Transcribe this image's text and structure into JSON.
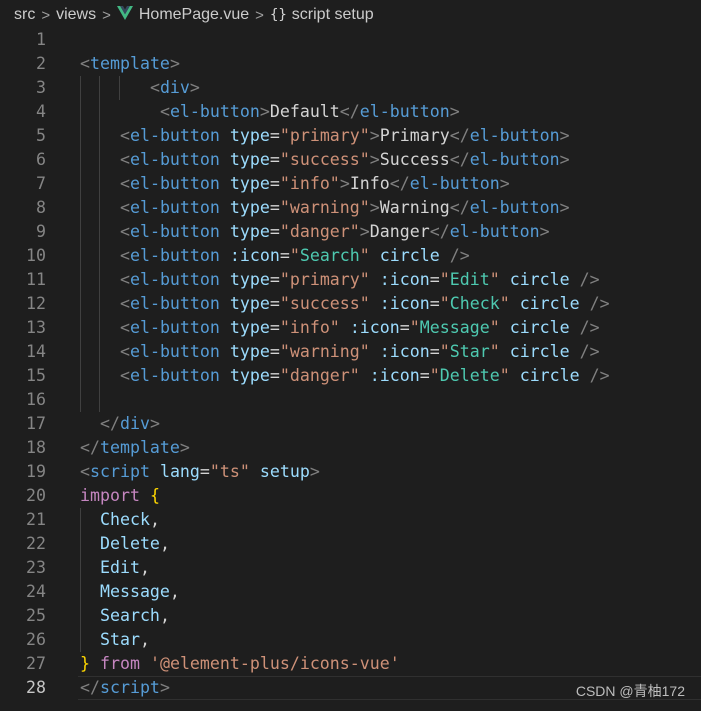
{
  "breadcrumb": {
    "segments": [
      "src",
      "views",
      "HomePage.vue",
      "script setup"
    ],
    "separator": ">",
    "file_icon": "vue-logo-icon",
    "symbol_icon": "braces-icon",
    "symbol_glyph": "{}"
  },
  "editor": {
    "active_line": 28,
    "lines": [
      {
        "n": "1",
        "t": []
      },
      {
        "n": "2",
        "t": [
          [
            "t-p",
            "<"
          ],
          [
            "t-tag",
            "template"
          ],
          [
            "t-p",
            ">"
          ]
        ]
      },
      {
        "n": "3",
        "t": [
          [
            "t-txt",
            "       "
          ],
          [
            "t-p",
            "<"
          ],
          [
            "t-tag",
            "div"
          ],
          [
            "t-p",
            ">"
          ]
        ]
      },
      {
        "n": "4",
        "t": [
          [
            "t-txt",
            "        "
          ],
          [
            "t-p",
            "<"
          ],
          [
            "t-tag",
            "el-button"
          ],
          [
            "t-p",
            ">"
          ],
          [
            "t-txt",
            "Default"
          ],
          [
            "t-p",
            "</"
          ],
          [
            "t-tag",
            "el-button"
          ],
          [
            "t-p",
            ">"
          ]
        ]
      },
      {
        "n": "5",
        "t": [
          [
            "t-txt",
            "    "
          ],
          [
            "t-p",
            "<"
          ],
          [
            "t-tag",
            "el-button"
          ],
          [
            "t-txt",
            " "
          ],
          [
            "t-attr",
            "type"
          ],
          [
            "t-eq",
            "="
          ],
          [
            "t-str",
            "\"primary\""
          ],
          [
            "t-p",
            ">"
          ],
          [
            "t-txt",
            "Primary"
          ],
          [
            "t-p",
            "</"
          ],
          [
            "t-tag",
            "el-button"
          ],
          [
            "t-p",
            ">"
          ]
        ]
      },
      {
        "n": "6",
        "t": [
          [
            "t-txt",
            "    "
          ],
          [
            "t-p",
            "<"
          ],
          [
            "t-tag",
            "el-button"
          ],
          [
            "t-txt",
            " "
          ],
          [
            "t-attr",
            "type"
          ],
          [
            "t-eq",
            "="
          ],
          [
            "t-str",
            "\"success\""
          ],
          [
            "t-p",
            ">"
          ],
          [
            "t-txt",
            "Success"
          ],
          [
            "t-p",
            "</"
          ],
          [
            "t-tag",
            "el-button"
          ],
          [
            "t-p",
            ">"
          ]
        ]
      },
      {
        "n": "7",
        "t": [
          [
            "t-txt",
            "    "
          ],
          [
            "t-p",
            "<"
          ],
          [
            "t-tag",
            "el-button"
          ],
          [
            "t-txt",
            " "
          ],
          [
            "t-attr",
            "type"
          ],
          [
            "t-eq",
            "="
          ],
          [
            "t-str",
            "\"info\""
          ],
          [
            "t-p",
            ">"
          ],
          [
            "t-txt",
            "Info"
          ],
          [
            "t-p",
            "</"
          ],
          [
            "t-tag",
            "el-button"
          ],
          [
            "t-p",
            ">"
          ]
        ]
      },
      {
        "n": "8",
        "t": [
          [
            "t-txt",
            "    "
          ],
          [
            "t-p",
            "<"
          ],
          [
            "t-tag",
            "el-button"
          ],
          [
            "t-txt",
            " "
          ],
          [
            "t-attr",
            "type"
          ],
          [
            "t-eq",
            "="
          ],
          [
            "t-str",
            "\"warning\""
          ],
          [
            "t-p",
            ">"
          ],
          [
            "t-txt",
            "Warning"
          ],
          [
            "t-p",
            "</"
          ],
          [
            "t-tag",
            "el-button"
          ],
          [
            "t-p",
            ">"
          ]
        ]
      },
      {
        "n": "9",
        "t": [
          [
            "t-txt",
            "    "
          ],
          [
            "t-p",
            "<"
          ],
          [
            "t-tag",
            "el-button"
          ],
          [
            "t-txt",
            " "
          ],
          [
            "t-attr",
            "type"
          ],
          [
            "t-eq",
            "="
          ],
          [
            "t-str",
            "\"danger\""
          ],
          [
            "t-p",
            ">"
          ],
          [
            "t-txt",
            "Danger"
          ],
          [
            "t-p",
            "</"
          ],
          [
            "t-tag",
            "el-button"
          ],
          [
            "t-p",
            ">"
          ]
        ]
      },
      {
        "n": "10",
        "t": [
          [
            "t-txt",
            "    "
          ],
          [
            "t-p",
            "<"
          ],
          [
            "t-tag",
            "el-button"
          ],
          [
            "t-txt",
            " "
          ],
          [
            "t-attr",
            ":icon"
          ],
          [
            "t-eq",
            "="
          ],
          [
            "t-str",
            "\""
          ],
          [
            "t-icon",
            "Search"
          ],
          [
            "t-str",
            "\""
          ],
          [
            "t-txt",
            " "
          ],
          [
            "t-attr",
            "circle"
          ],
          [
            "t-txt",
            " "
          ],
          [
            "t-p",
            "/>"
          ]
        ]
      },
      {
        "n": "11",
        "t": [
          [
            "t-txt",
            "    "
          ],
          [
            "t-p",
            "<"
          ],
          [
            "t-tag",
            "el-button"
          ],
          [
            "t-txt",
            " "
          ],
          [
            "t-attr",
            "type"
          ],
          [
            "t-eq",
            "="
          ],
          [
            "t-str",
            "\"primary\""
          ],
          [
            "t-txt",
            " "
          ],
          [
            "t-attr",
            ":icon"
          ],
          [
            "t-eq",
            "="
          ],
          [
            "t-str",
            "\""
          ],
          [
            "t-icon",
            "Edit"
          ],
          [
            "t-str",
            "\""
          ],
          [
            "t-txt",
            " "
          ],
          [
            "t-attr",
            "circle"
          ],
          [
            "t-txt",
            " "
          ],
          [
            "t-p",
            "/>"
          ]
        ]
      },
      {
        "n": "12",
        "t": [
          [
            "t-txt",
            "    "
          ],
          [
            "t-p",
            "<"
          ],
          [
            "t-tag",
            "el-button"
          ],
          [
            "t-txt",
            " "
          ],
          [
            "t-attr",
            "type"
          ],
          [
            "t-eq",
            "="
          ],
          [
            "t-str",
            "\"success\""
          ],
          [
            "t-txt",
            " "
          ],
          [
            "t-attr",
            ":icon"
          ],
          [
            "t-eq",
            "="
          ],
          [
            "t-str",
            "\""
          ],
          [
            "t-icon",
            "Check"
          ],
          [
            "t-str",
            "\""
          ],
          [
            "t-txt",
            " "
          ],
          [
            "t-attr",
            "circle"
          ],
          [
            "t-txt",
            " "
          ],
          [
            "t-p",
            "/>"
          ]
        ]
      },
      {
        "n": "13",
        "t": [
          [
            "t-txt",
            "    "
          ],
          [
            "t-p",
            "<"
          ],
          [
            "t-tag",
            "el-button"
          ],
          [
            "t-txt",
            " "
          ],
          [
            "t-attr",
            "type"
          ],
          [
            "t-eq",
            "="
          ],
          [
            "t-str",
            "\"info\""
          ],
          [
            "t-txt",
            " "
          ],
          [
            "t-attr",
            ":icon"
          ],
          [
            "t-eq",
            "="
          ],
          [
            "t-str",
            "\""
          ],
          [
            "t-icon",
            "Message"
          ],
          [
            "t-str",
            "\""
          ],
          [
            "t-txt",
            " "
          ],
          [
            "t-attr",
            "circle"
          ],
          [
            "t-txt",
            " "
          ],
          [
            "t-p",
            "/>"
          ]
        ]
      },
      {
        "n": "14",
        "t": [
          [
            "t-txt",
            "    "
          ],
          [
            "t-p",
            "<"
          ],
          [
            "t-tag",
            "el-button"
          ],
          [
            "t-txt",
            " "
          ],
          [
            "t-attr",
            "type"
          ],
          [
            "t-eq",
            "="
          ],
          [
            "t-str",
            "\"warning\""
          ],
          [
            "t-txt",
            " "
          ],
          [
            "t-attr",
            ":icon"
          ],
          [
            "t-eq",
            "="
          ],
          [
            "t-str",
            "\""
          ],
          [
            "t-icon",
            "Star"
          ],
          [
            "t-str",
            "\""
          ],
          [
            "t-txt",
            " "
          ],
          [
            "t-attr",
            "circle"
          ],
          [
            "t-txt",
            " "
          ],
          [
            "t-p",
            "/>"
          ]
        ]
      },
      {
        "n": "15",
        "t": [
          [
            "t-txt",
            "    "
          ],
          [
            "t-p",
            "<"
          ],
          [
            "t-tag",
            "el-button"
          ],
          [
            "t-txt",
            " "
          ],
          [
            "t-attr",
            "type"
          ],
          [
            "t-eq",
            "="
          ],
          [
            "t-str",
            "\"danger\""
          ],
          [
            "t-txt",
            " "
          ],
          [
            "t-attr",
            ":icon"
          ],
          [
            "t-eq",
            "="
          ],
          [
            "t-str",
            "\""
          ],
          [
            "t-icon",
            "Delete"
          ],
          [
            "t-str",
            "\""
          ],
          [
            "t-txt",
            " "
          ],
          [
            "t-attr",
            "circle"
          ],
          [
            "t-txt",
            " "
          ],
          [
            "t-p",
            "/>"
          ]
        ]
      },
      {
        "n": "16",
        "t": []
      },
      {
        "n": "17",
        "t": [
          [
            "t-txt",
            "  "
          ],
          [
            "t-p",
            "</"
          ],
          [
            "t-tag",
            "div"
          ],
          [
            "t-p",
            ">"
          ]
        ]
      },
      {
        "n": "18",
        "t": [
          [
            "t-p",
            "</"
          ],
          [
            "t-tag",
            "template"
          ],
          [
            "t-p",
            ">"
          ]
        ]
      },
      {
        "n": "19",
        "t": [
          [
            "t-p",
            "<"
          ],
          [
            "t-tag",
            "script"
          ],
          [
            "t-txt",
            " "
          ],
          [
            "t-attr",
            "lang"
          ],
          [
            "t-eq",
            "="
          ],
          [
            "t-str",
            "\"ts\""
          ],
          [
            "t-txt",
            " "
          ],
          [
            "t-attr",
            "setup"
          ],
          [
            "t-p",
            ">"
          ]
        ]
      },
      {
        "n": "20",
        "t": [
          [
            "t-kw",
            "import"
          ],
          [
            "t-txt",
            " "
          ],
          [
            "t-brace",
            "{"
          ]
        ]
      },
      {
        "n": "21",
        "t": [
          [
            "t-txt",
            "  "
          ],
          [
            "t-var",
            "Check"
          ],
          [
            "t-txt",
            ","
          ]
        ]
      },
      {
        "n": "22",
        "t": [
          [
            "t-txt",
            "  "
          ],
          [
            "t-var",
            "Delete"
          ],
          [
            "t-txt",
            ","
          ]
        ]
      },
      {
        "n": "23",
        "t": [
          [
            "t-txt",
            "  "
          ],
          [
            "t-var",
            "Edit"
          ],
          [
            "t-txt",
            ","
          ]
        ]
      },
      {
        "n": "24",
        "t": [
          [
            "t-txt",
            "  "
          ],
          [
            "t-var",
            "Message"
          ],
          [
            "t-txt",
            ","
          ]
        ]
      },
      {
        "n": "25",
        "t": [
          [
            "t-txt",
            "  "
          ],
          [
            "t-var",
            "Search"
          ],
          [
            "t-txt",
            ","
          ]
        ]
      },
      {
        "n": "26",
        "t": [
          [
            "t-txt",
            "  "
          ],
          [
            "t-var",
            "Star"
          ],
          [
            "t-txt",
            ","
          ]
        ]
      },
      {
        "n": "27",
        "t": [
          [
            "t-brace",
            "}"
          ],
          [
            "t-txt",
            " "
          ],
          [
            "t-kw",
            "from"
          ],
          [
            "t-txt",
            " "
          ],
          [
            "t-str",
            "'@element-plus/icons-vue'"
          ]
        ]
      },
      {
        "n": "28",
        "t": [
          [
            "t-p",
            "</"
          ],
          [
            "t-tag",
            "script"
          ],
          [
            "t-p",
            ">"
          ]
        ]
      }
    ]
  },
  "watermark": "CSDN @青柚172"
}
